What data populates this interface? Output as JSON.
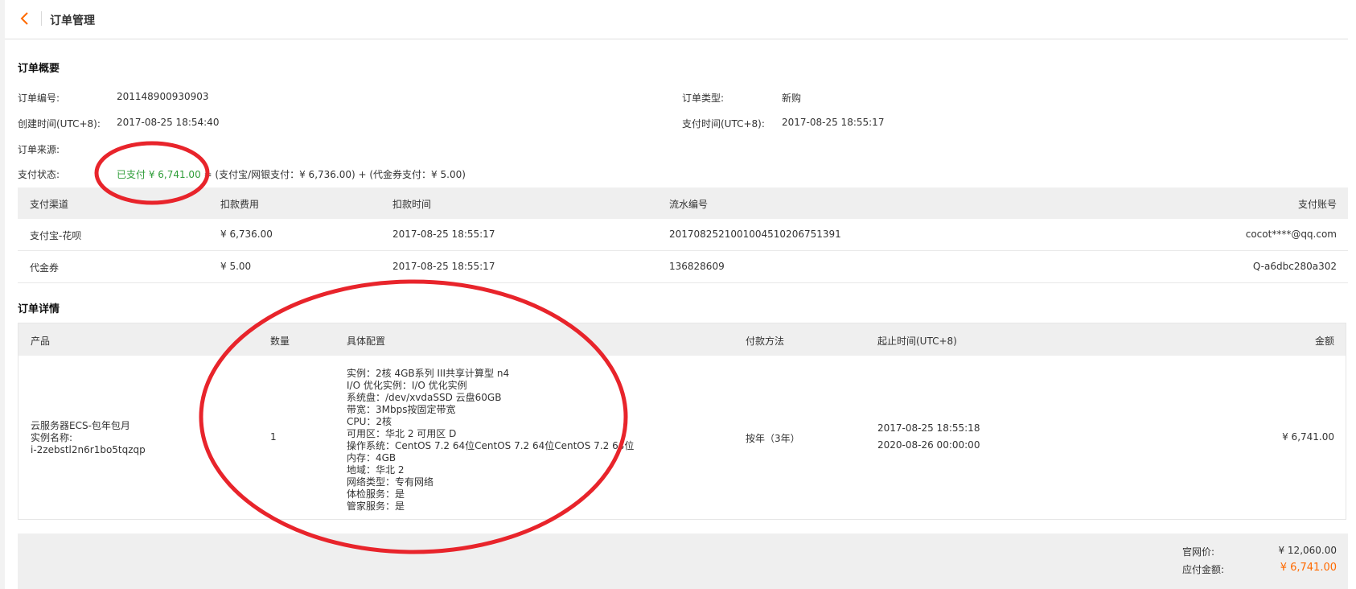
{
  "header": {
    "back_icon": "chevron-left-icon",
    "title": "订单管理"
  },
  "overview": {
    "section_title": "订单概要",
    "order_no_label": "订单编号:",
    "order_no": "201148900930903",
    "order_type_label": "订单类型:",
    "order_type": "新购",
    "created_label": "创建时间(UTC+8):",
    "created": "2017-08-25 18:54:40",
    "paid_time_label": "支付时间(UTC+8):",
    "paid_time": "2017-08-25 18:55:17",
    "source_label": "订单来源:",
    "source": "",
    "pay_status_label": "支付状态:",
    "pay_status_paid": "已支付 ¥ 6,741.00",
    "pay_status_breakdown": " = (支付宝/网银支付：¥ 6,736.00) + (代金券支付：¥ 5.00)"
  },
  "payments": {
    "headers": [
      "支付渠道",
      "扣款费用",
      "扣款时间",
      "流水编号",
      "支付账号"
    ],
    "rows": [
      [
        "支付宝-花呗",
        "¥ 6,736.00",
        "2017-08-25 18:55:17",
        "2017082521001004510206751391",
        "cocot****@qq.com"
      ],
      [
        "代金券",
        "¥ 5.00",
        "2017-08-25 18:55:17",
        "136828609",
        "Q-a6dbc280a302"
      ]
    ]
  },
  "details": {
    "section_title": "订单详情",
    "headers": [
      "产品",
      "数量",
      "具体配置",
      "付款方法",
      "起止时间(UTC+8)",
      "金额"
    ],
    "product_line1": "云服务器ECS-包年包月",
    "product_line2": "实例名称:",
    "product_line3": "i-2zebstl2n6r1bo5tqzqp",
    "quantity": "1",
    "config": [
      "实例：2核 4GB系列 III共享计算型 n4",
      "I/O 优化实例：I/O 优化实例",
      "系统盘：/dev/xvdaSSD 云盘60GB",
      "带宽：3Mbps按固定带宽",
      "CPU：2核",
      "可用区：华北 2 可用区 D",
      "操作系统：CentOS 7.2 64位CentOS 7.2 64位CentOS 7.2 64位",
      "内存：4GB",
      "地域：华北 2",
      "网络类型：专有网络",
      "体检服务：是",
      "管家服务：是"
    ],
    "pay_method": "按年（3年）",
    "start": "2017-08-25 18:55:18",
    "end": "2020-08-26 00:00:00",
    "amount": "¥ 6,741.00"
  },
  "summary": {
    "list_price_label": "官网价:",
    "list_price": "¥ 12,060.00",
    "due_label": "应付金额:",
    "due": "¥ 6,741.00"
  },
  "colors": {
    "accent": "#ff6a00",
    "paid_green": "#2f9d39",
    "annotation_red": "#e8242b",
    "header_bg": "#efefef"
  }
}
